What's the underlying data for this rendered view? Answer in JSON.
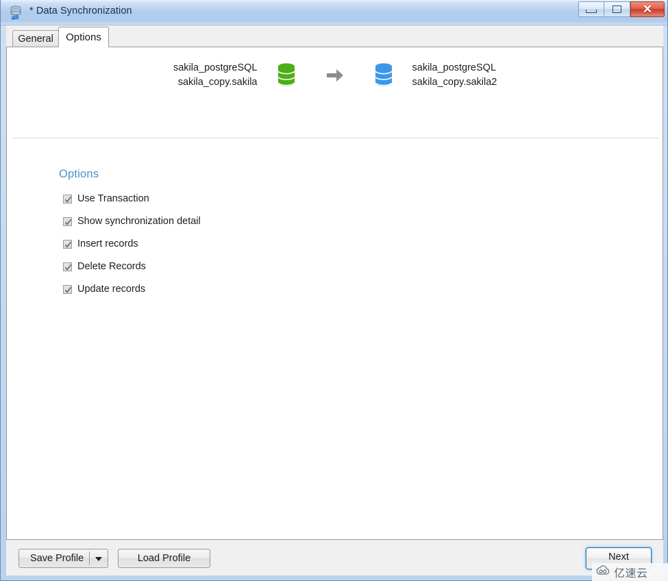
{
  "window": {
    "title": "* Data Synchronization",
    "icon": "database-sync-icon",
    "controls": {
      "minimize": "minimize-button",
      "maximize": "maximize-button",
      "close_glyph": "✕"
    }
  },
  "tabs": [
    {
      "label": "General",
      "active": false
    },
    {
      "label": "Options",
      "active": true
    }
  ],
  "sync_header": {
    "source": {
      "connection": "sakila_postgreSQL",
      "schema": "sakila_copy.sakila",
      "icon_color": "#4caf18"
    },
    "arrow": "arrow-right-icon",
    "target": {
      "connection": "sakila_postgreSQL",
      "schema": "sakila_copy.sakila2",
      "icon_color": "#3d97e8"
    }
  },
  "options": {
    "heading": "Options",
    "heading_color": "#4a92c8",
    "items": [
      {
        "label": "Use Transaction",
        "checked": true
      },
      {
        "label": "Show synchronization detail",
        "checked": true
      },
      {
        "label": "Insert records",
        "checked": true
      },
      {
        "label": "Delete Records",
        "checked": true
      },
      {
        "label": "Update records",
        "checked": true
      }
    ]
  },
  "footer": {
    "save_profile": "Save Profile",
    "load_profile": "Load Profile",
    "next": "Next"
  },
  "watermark": {
    "text": "亿速云"
  }
}
